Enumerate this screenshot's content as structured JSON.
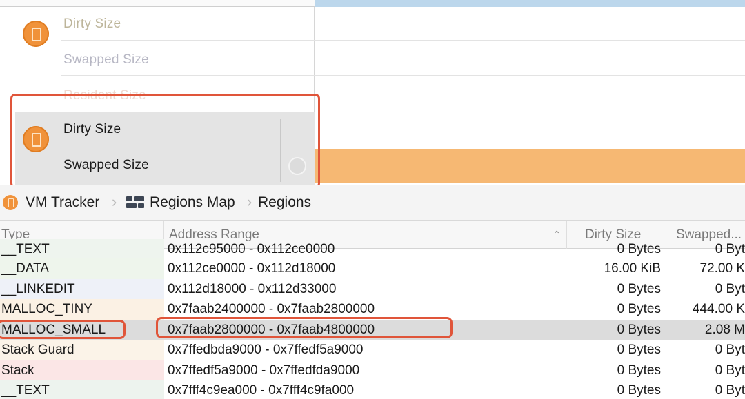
{
  "track_labels": {
    "dirty": "Dirty Size",
    "swapped": "Swapped Size",
    "resident": "Resident Size",
    "selected_dirty": "Dirty Size",
    "selected_swapped": "Swapped Size"
  },
  "breadcrumb": {
    "instrument": "VM Tracker",
    "view": "Regions Map",
    "detail": "Regions"
  },
  "table": {
    "headers": {
      "type": "Type",
      "address": "Address Range",
      "dirty": "Dirty Size",
      "swapped": "Swapped..."
    },
    "rows": [
      {
        "type": "__TEXT",
        "address": "0x112c95000 - 0x112ce0000",
        "dirty": "0 Bytes",
        "swapped": "0 Byt"
      },
      {
        "type": "__DATA",
        "address": "0x112ce0000 - 0x112d18000",
        "dirty": "16.00 KiB",
        "swapped": "72.00 K"
      },
      {
        "type": "__LINKEDIT",
        "address": "0x112d18000 - 0x112d33000",
        "dirty": "0 Bytes",
        "swapped": "0 Byt"
      },
      {
        "type": "MALLOC_TINY",
        "address": "0x7faab2400000 - 0x7faab2800000",
        "dirty": "0 Bytes",
        "swapped": "444.00 K"
      },
      {
        "type": "MALLOC_SMALL",
        "address": "0x7faab2800000 - 0x7faab4800000",
        "dirty": "0 Bytes",
        "swapped": "2.08 M"
      },
      {
        "type": "Stack Guard",
        "address": "0x7ffedbda9000 - 0x7ffedf5a9000",
        "dirty": "0 Bytes",
        "swapped": "0 Byt"
      },
      {
        "type": "Stack",
        "address": "0x7ffedf5a9000 - 0x7ffedfda9000",
        "dirty": "0 Bytes",
        "swapped": "0 Byt"
      },
      {
        "type": "__TEXT",
        "address": "0x7fff4c9ea000 - 0x7fff4c9fa000",
        "dirty": "0 Bytes",
        "swapped": "0 Byt"
      }
    ],
    "selected_row": "MALLOC_SMALL"
  },
  "colors": {
    "accent_orange": "#f0923a",
    "highlight_red": "#e0553a",
    "timeline_band": "#f6b873",
    "timeline_top": "#bcd7ec"
  },
  "icons": {
    "instrument": "vm-tracker-icon",
    "regions_map": "regions-map-icon",
    "sort": "sort-ascending-icon"
  }
}
